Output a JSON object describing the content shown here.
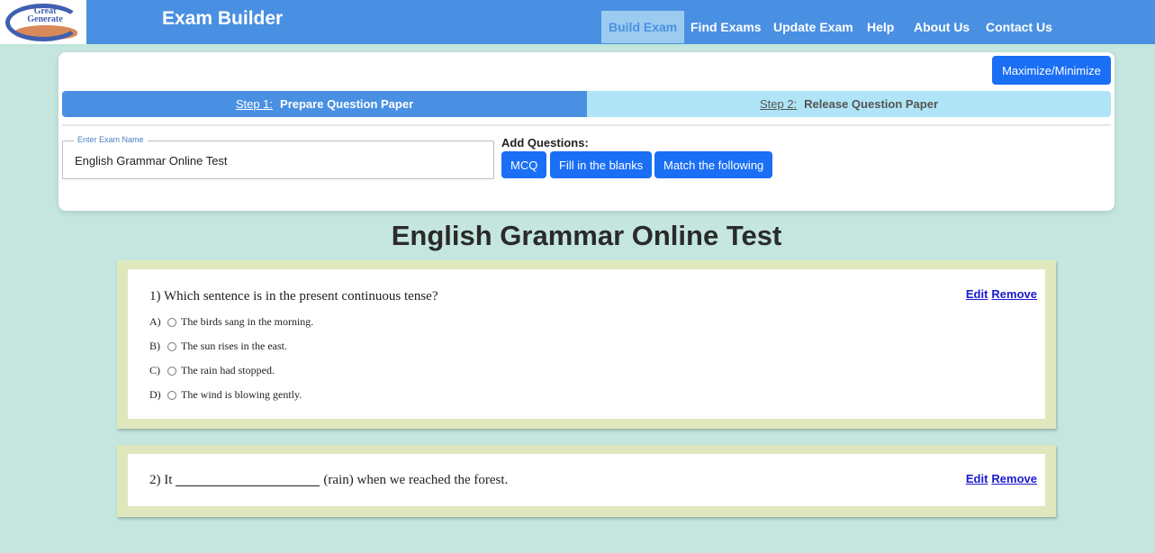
{
  "brand": {
    "logo_text_1": "Great",
    "logo_text_2": "Generate"
  },
  "app_title": "Exam Builder",
  "nav": [
    {
      "label": "Build Exam",
      "active": true
    },
    {
      "label": "Find Exams"
    },
    {
      "label": "Update Exam"
    },
    {
      "label": "Help"
    },
    {
      "label": "About Us"
    },
    {
      "label": "Contact Us"
    }
  ],
  "builder": {
    "maximize_label": "Maximize/Minimize",
    "steps": [
      {
        "num": "Step 1:",
        "label": "Prepare Question Paper"
      },
      {
        "num": "Step 2:",
        "label": "Release Question Paper"
      }
    ],
    "exam_name_legend": "Enter Exam Name",
    "exam_name_value": "English Grammar Online Test",
    "add_questions_label": "Add Questions:",
    "question_types": [
      "MCQ",
      "Fill in the blanks",
      "Match the following"
    ]
  },
  "paper": {
    "title": "English Grammar Online Test",
    "edit_label": "Edit",
    "remove_label": "Remove",
    "questions": [
      {
        "number": "1)",
        "text": "Which sentence is in the present continuous tense?",
        "options": [
          {
            "letter": "A)",
            "text": "The birds sang in the morning."
          },
          {
            "letter": "B)",
            "text": "The sun rises in the east."
          },
          {
            "letter": "C)",
            "text": "The rain had stopped."
          },
          {
            "letter": "D)",
            "text": "The wind is blowing gently."
          }
        ]
      },
      {
        "number": "2)",
        "text_before": "It",
        "text_after": "(rain) when we reached the forest."
      }
    ]
  },
  "colors": {
    "header": "#4a90e2",
    "background": "#c4e6df",
    "button": "#1a6ff5",
    "question_border": "#dfe8bd"
  }
}
